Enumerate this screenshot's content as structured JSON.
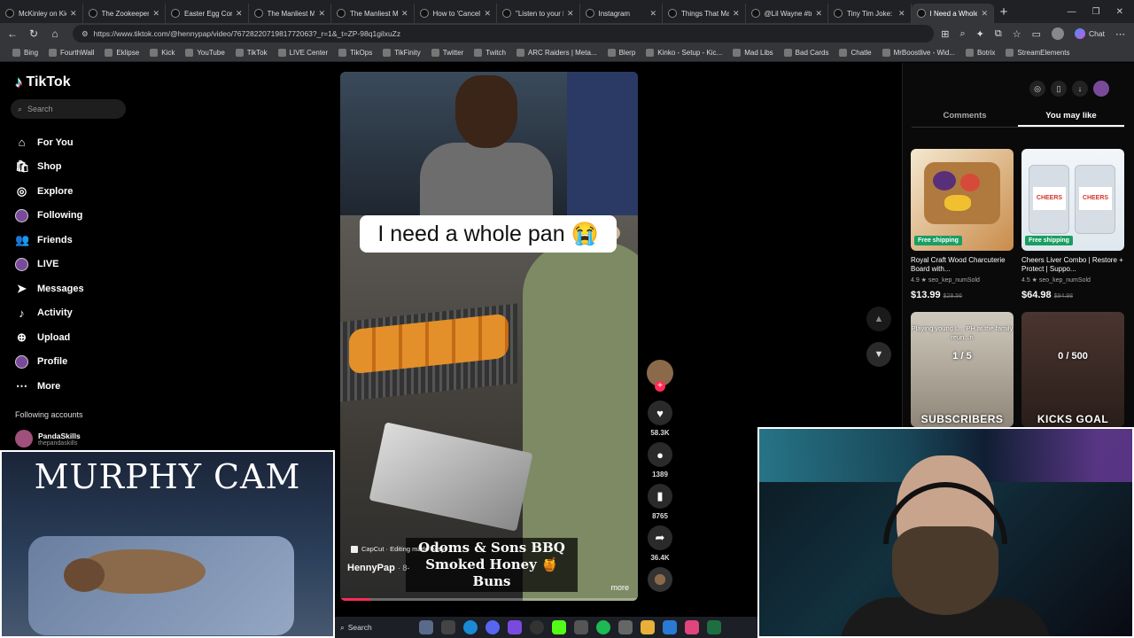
{
  "browser": {
    "tabs": [
      {
        "title": "McKinley on Kick",
        "active": false
      },
      {
        "title": "The Zookeeper a",
        "active": false
      },
      {
        "title": "Easter Egg Confe",
        "active": false
      },
      {
        "title": "The Manliest Ma",
        "active": false
      },
      {
        "title": "The Manliest Ma",
        "active": false
      },
      {
        "title": "How to 'Cancel' W",
        "active": false
      },
      {
        "title": "\"Listen to your b",
        "active": false
      },
      {
        "title": "Instagram",
        "active": false
      },
      {
        "title": "Things That Make",
        "active": false
      },
      {
        "title": "@Lil Wayne #tru",
        "active": false
      },
      {
        "title": "Tiny Tim Joke: Sh",
        "active": false
      },
      {
        "title": "I Need a Whole P",
        "active": true
      }
    ],
    "url": "https://www.tiktok.com/@hennypap/video/7672822071981772063?_r=1&_t=ZP-98q1gilxuZz",
    "chat_label": "Chat",
    "bookmarks": [
      "Bing",
      "FourthWall",
      "Eklipse",
      "Kick",
      "YouTube",
      "TikTok",
      "LIVE Center",
      "TikOps",
      "TikFinity",
      "Twitter",
      "Twitch",
      "ARC Raiders | Meta...",
      "Blerp",
      "Kinko - Setup - Kic...",
      "Mad Libs",
      "Bad Cards",
      "Chatle",
      "MrBoostlive - Wid...",
      "Botrix",
      "StreamElements"
    ]
  },
  "tiktok": {
    "logo": "TikTok",
    "search_placeholder": "Search",
    "nav": [
      {
        "label": "For You",
        "icon": "home-icon"
      },
      {
        "label": "Shop",
        "icon": "shop-icon"
      },
      {
        "label": "Explore",
        "icon": "compass-icon"
      },
      {
        "label": "Following",
        "icon": "avatar-icon"
      },
      {
        "label": "Friends",
        "icon": "friends-icon"
      },
      {
        "label": "LIVE",
        "icon": "live-icon"
      },
      {
        "label": "Messages",
        "icon": "send-icon"
      },
      {
        "label": "Activity",
        "icon": "activity-icon"
      },
      {
        "label": "Upload",
        "icon": "upload-icon"
      },
      {
        "label": "Profile",
        "icon": "profile-avatar-icon"
      },
      {
        "label": "More",
        "icon": "more-icon"
      }
    ],
    "following_accounts_title": "Following accounts",
    "following_account": {
      "name": "PandaSkills",
      "handle": "thepandaskills"
    },
    "video": {
      "caption": "I need a whole pan 😭",
      "capcut": "CapCut · Editing made easy",
      "author": "HennyPap",
      "age": "· 8-",
      "overlay_line1": "Odoms & Sons BBQ",
      "overlay_line2": "Smoked Honey 🍯 Buns",
      "more": "more",
      "progress": 0.1
    },
    "actions": {
      "likes": "58.3K",
      "comments": "1389",
      "saves": "8765",
      "shares": "36.4K"
    },
    "right_tabs": [
      "Comments",
      "You may like"
    ],
    "products": [
      {
        "badge": "Free shipping",
        "name": "Royal Craft Wood Charcuterie Board with...",
        "rating": "4.9 ★",
        "sold": "seo_kep_numSold",
        "price": "$13.99",
        "old_price": "$28.56"
      },
      {
        "badge": "Free shipping",
        "name": "Cheers Liver Combo | Restore + Protect | Suppo...",
        "rating": "4.5 ★",
        "sold": "seo_kep_numSold",
        "price": "$64.98",
        "old_price": "$94.98"
      }
    ],
    "jar_label": "CHEERS",
    "tiles": [
      {
        "top": "Playing young L... PH at the family reun...n",
        "mid": "1 / 5",
        "bottom": "SUBSCRIBERS"
      },
      {
        "top": "",
        "mid": "0 / 500",
        "bottom": "KICKS GOAL"
      }
    ]
  },
  "overlays": {
    "murphy_cam": "MURPHY CAM"
  },
  "taskbar": {
    "search": "Search"
  }
}
